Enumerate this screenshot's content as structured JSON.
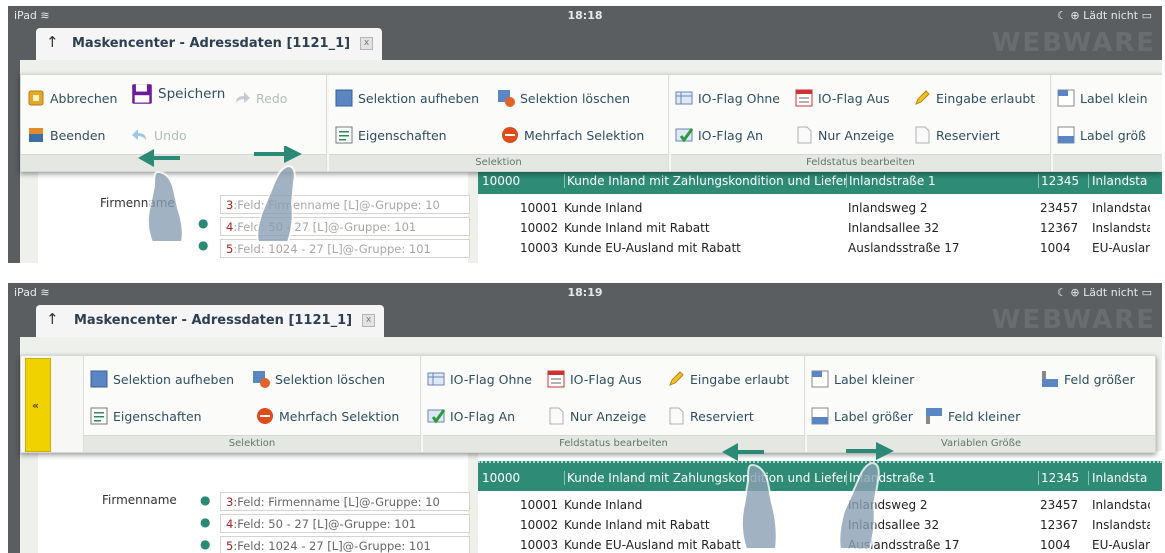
{
  "status": {
    "device": "iPad",
    "wifi_icon": "wifi-icon",
    "battery_text": "Lädt nicht",
    "battery_icon": "battery-icon"
  },
  "screens": [
    {
      "time": "18:18",
      "tab_title": "Maskencenter - Adressdaten [1121_1]",
      "tab_close": "x",
      "watermark": "WEBWARE",
      "groups": [
        {
          "caption": "",
          "items": [
            "Abbrechen",
            "Speichern",
            "Redo",
            "Beenden",
            "Undo"
          ]
        },
        {
          "caption": "Selektion",
          "items": [
            "Selektion aufheben",
            "Selektion löschen",
            "Eigenschaften",
            "Mehrfach Selektion"
          ]
        },
        {
          "caption": "Feldstatus bearbeiten",
          "items": [
            "IO-Flag Ohne",
            "IO-Flag Aus",
            "Eingabe erlaubt",
            "IO-Flag An",
            "Nur Anzeige",
            "Reserviert"
          ]
        },
        {
          "caption": "",
          "items": [
            "Label klein",
            "Label größ"
          ]
        }
      ],
      "form": {
        "label": "Firmenname",
        "fields": [
          {
            "num": "3",
            "text": ":Feld: Firmenname  [L]@-Gruppe: 10"
          },
          {
            "num": "4",
            "text": ":Feld: 50 - 27 [L]@-Gruppe: 101"
          },
          {
            "num": "5",
            "text": ":Feld: 1024 - 27 [L]@-Gruppe: 101"
          }
        ]
      },
      "grid": {
        "header": [
          "10000",
          "Kunde Inland mit Zahlungskondition und Lieferbed.",
          "Inlandstraße 1",
          "12345",
          "Inlandstadt"
        ],
        "rows": [
          [
            "10001",
            "Kunde Inland",
            "Inlandsweg 2",
            "23457",
            "Inlandstadt"
          ],
          [
            "10002",
            "Kunde Inland mit Rabatt",
            "Inlandsallee 32",
            "12367",
            "Inslandstadt"
          ],
          [
            "10003",
            "Kunde EU-Ausland mit Rabatt",
            "Auslandsstraße 17",
            "1004",
            "EU-Ausland"
          ]
        ]
      }
    },
    {
      "time": "18:19",
      "tab_title": "Maskencenter - Adressdaten [1121_1]",
      "tab_close": "x",
      "watermark": "WEBWARE",
      "side_handle": "«",
      "groups": [
        {
          "caption": "Selektion",
          "items": [
            "Selektion aufheben",
            "Selektion löschen",
            "Eigenschaften",
            "Mehrfach Selektion"
          ]
        },
        {
          "caption": "Feldstatus bearbeiten",
          "items": [
            "IO-Flag Ohne",
            "IO-Flag Aus",
            "Eingabe erlaubt",
            "IO-Flag An",
            "Nur Anzeige",
            "Reserviert"
          ]
        },
        {
          "caption": "Variablen Größe",
          "items": [
            "Label kleiner",
            "Feld größer",
            "Label größer",
            "Feld kleiner"
          ]
        }
      ],
      "form": {
        "label": "Firmenname",
        "fields": [
          {
            "num": "3",
            "text": ":Feld: Firmenname  [L]@-Gruppe: 10"
          },
          {
            "num": "4",
            "text": ":Feld: 50 - 27 [L]@-Gruppe: 101"
          },
          {
            "num": "5",
            "text": ":Feld: 1024 - 27 [L]@-Gruppe: 101"
          }
        ]
      },
      "grid": {
        "header": [
          "10000",
          "Kunde Inland mit Zahlungskondition und Lieferbed.",
          "Inlandstraße 1",
          "12345",
          "Inlandstadt"
        ],
        "rows": [
          [
            "10001",
            "Kunde Inland",
            "Inlandsweg 2",
            "23457",
            "Inlandstadt"
          ],
          [
            "10002",
            "Kunde Inland mit Rabatt",
            "Inlandsallee 32",
            "12367",
            "Inslandstadt"
          ],
          [
            "10003",
            "Kunde EU-Ausland mit Rabatt",
            "Auslandsstraße 17",
            "1004",
            "EU-Ausland"
          ]
        ]
      }
    }
  ],
  "colors": {
    "accent_green": "#2e8b75",
    "toolbar_text": "#2f4e5f",
    "status_bar": "#5a5e61",
    "side_handle": "#f0d200"
  }
}
